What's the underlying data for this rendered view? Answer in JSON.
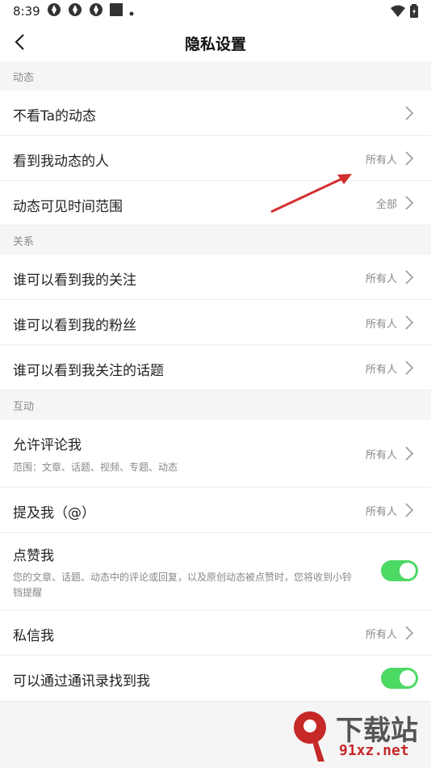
{
  "status_bar": {
    "time": "8:39"
  },
  "header": {
    "title": "隐私设置"
  },
  "sections": {
    "dynamics": "动态",
    "relations": "关系",
    "interaction": "互动"
  },
  "rows": {
    "hide_ta": {
      "label": "不看Ta的动态"
    },
    "who_sees_dynamics": {
      "label": "看到我动态的人",
      "value": "所有人"
    },
    "visible_range": {
      "label": "动态可见时间范围",
      "value": "全部"
    },
    "who_sees_follows": {
      "label": "谁可以看到我的关注",
      "value": "所有人"
    },
    "who_sees_fans": {
      "label": "谁可以看到我的粉丝",
      "value": "所有人"
    },
    "who_sees_topics": {
      "label": "谁可以看到我关注的话题",
      "value": "所有人"
    },
    "allow_comment": {
      "label": "允许评论我",
      "sub": "范围：文章、话题、视频、专题、动态",
      "value": "所有人"
    },
    "mention": {
      "label": "提及我（@）",
      "value": "所有人"
    },
    "like": {
      "label": "点赞我",
      "sub": "您的文章、话题、动态中的评论或回复，以及原创动态被点赞时，您将收到小铃铛提醒",
      "enabled": true
    },
    "message": {
      "label": "私信我",
      "value": "所有人"
    },
    "contacts": {
      "label": "可以通过通讯录找到我",
      "enabled": true
    }
  },
  "watermark": {
    "line1": "下载站",
    "line2": "91xz.net"
  },
  "colors": {
    "toggle_on": "#4cd964",
    "arrow": "#d32f2f"
  }
}
